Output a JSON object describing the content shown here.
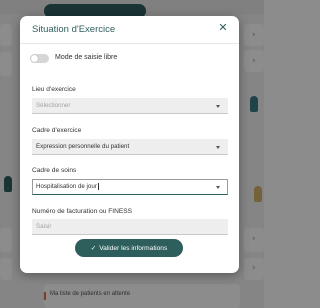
{
  "background": {
    "bottom_item_text": "Ma liste de patients en attente"
  },
  "modal": {
    "title": "Situation d'Exercice",
    "close_icon": "close-icon",
    "toggle": {
      "label": "Mode de saisie libre",
      "checked": false
    },
    "fields": {
      "lieu": {
        "label": "Lieu d'exercice",
        "placeholder": "Sélectionner",
        "value": ""
      },
      "cadre_exercice": {
        "label": "Cadre d'exercice",
        "value": "Expression personnelle du patient"
      },
      "cadre_soins": {
        "label": "Cadre de soins",
        "value": "Hospitalisation de jour"
      },
      "facturation": {
        "label": "Numéro de facturation ou FINESS",
        "placeholder": "Saisir",
        "value": ""
      }
    },
    "submit": {
      "label": "Valider les informations",
      "icon": "check-icon"
    }
  },
  "colors": {
    "accent": "#2e5f5d",
    "overlay": "rgba(0,0,0,0.45)",
    "field_bg": "#eeeeee"
  }
}
